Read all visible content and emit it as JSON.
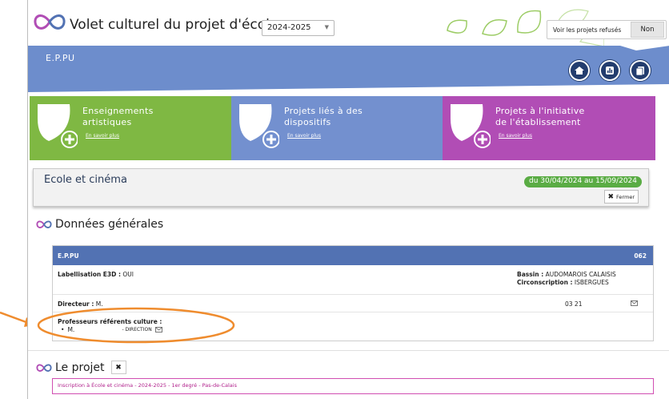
{
  "header": {
    "title": "Volet culturel du projet d'école",
    "year_selected": "2024-2025",
    "refused_label": "Voir les projets refusés",
    "refused_value": "Non"
  },
  "banner": {
    "etablissement": "E.P.PU",
    "nav_icons": [
      "home-icon",
      "stats-icon",
      "document-icon"
    ],
    "color": "#6d8dcc"
  },
  "tiles": [
    {
      "line1": "Enseignements",
      "line2": "artistiques",
      "more": "En savoir plus",
      "color": "#7fb843"
    },
    {
      "line1": "Projets liés à des",
      "line2": "dispositifs",
      "more": "En savoir plus",
      "color": "#7390cf"
    },
    {
      "line1": "Projets à l'initiative",
      "line2": "de l'établissement",
      "more": "En savoir plus",
      "color": "#b14db5"
    }
  ],
  "panel": {
    "title": "Ecole et cinéma",
    "date_range": "du 30/04/2024  au 15/09/2024",
    "close_label": "Fermer"
  },
  "general": {
    "heading": "Données générales",
    "school_name": "E.P.PU",
    "school_code": "062",
    "labellisation_label": "Labellisation E3D :",
    "labellisation_value": "OUI",
    "bassin_label": "Bassin :",
    "bassin_value": "AUDOMAROIS CALAISIS",
    "circo_label": "Circonscription :",
    "circo_value": "ISBERGUES",
    "director_label": "Directeur :",
    "director_value": "M.",
    "director_phone": "03 21",
    "referents_label": "Professeurs référents culture :",
    "referent_name": "M.",
    "referent_role": "- DIRECTION"
  },
  "projet": {
    "heading": "Le projet",
    "inscription": "Inscription à École et cinéma - 2024-2025 - 1er degré - Pas-de-Calais"
  },
  "colors": {
    "accent_blue": "#5272b3",
    "highlight_orange": "#ef8c2e",
    "green_badge": "#5aac44",
    "magenta": "#d14fb2"
  }
}
